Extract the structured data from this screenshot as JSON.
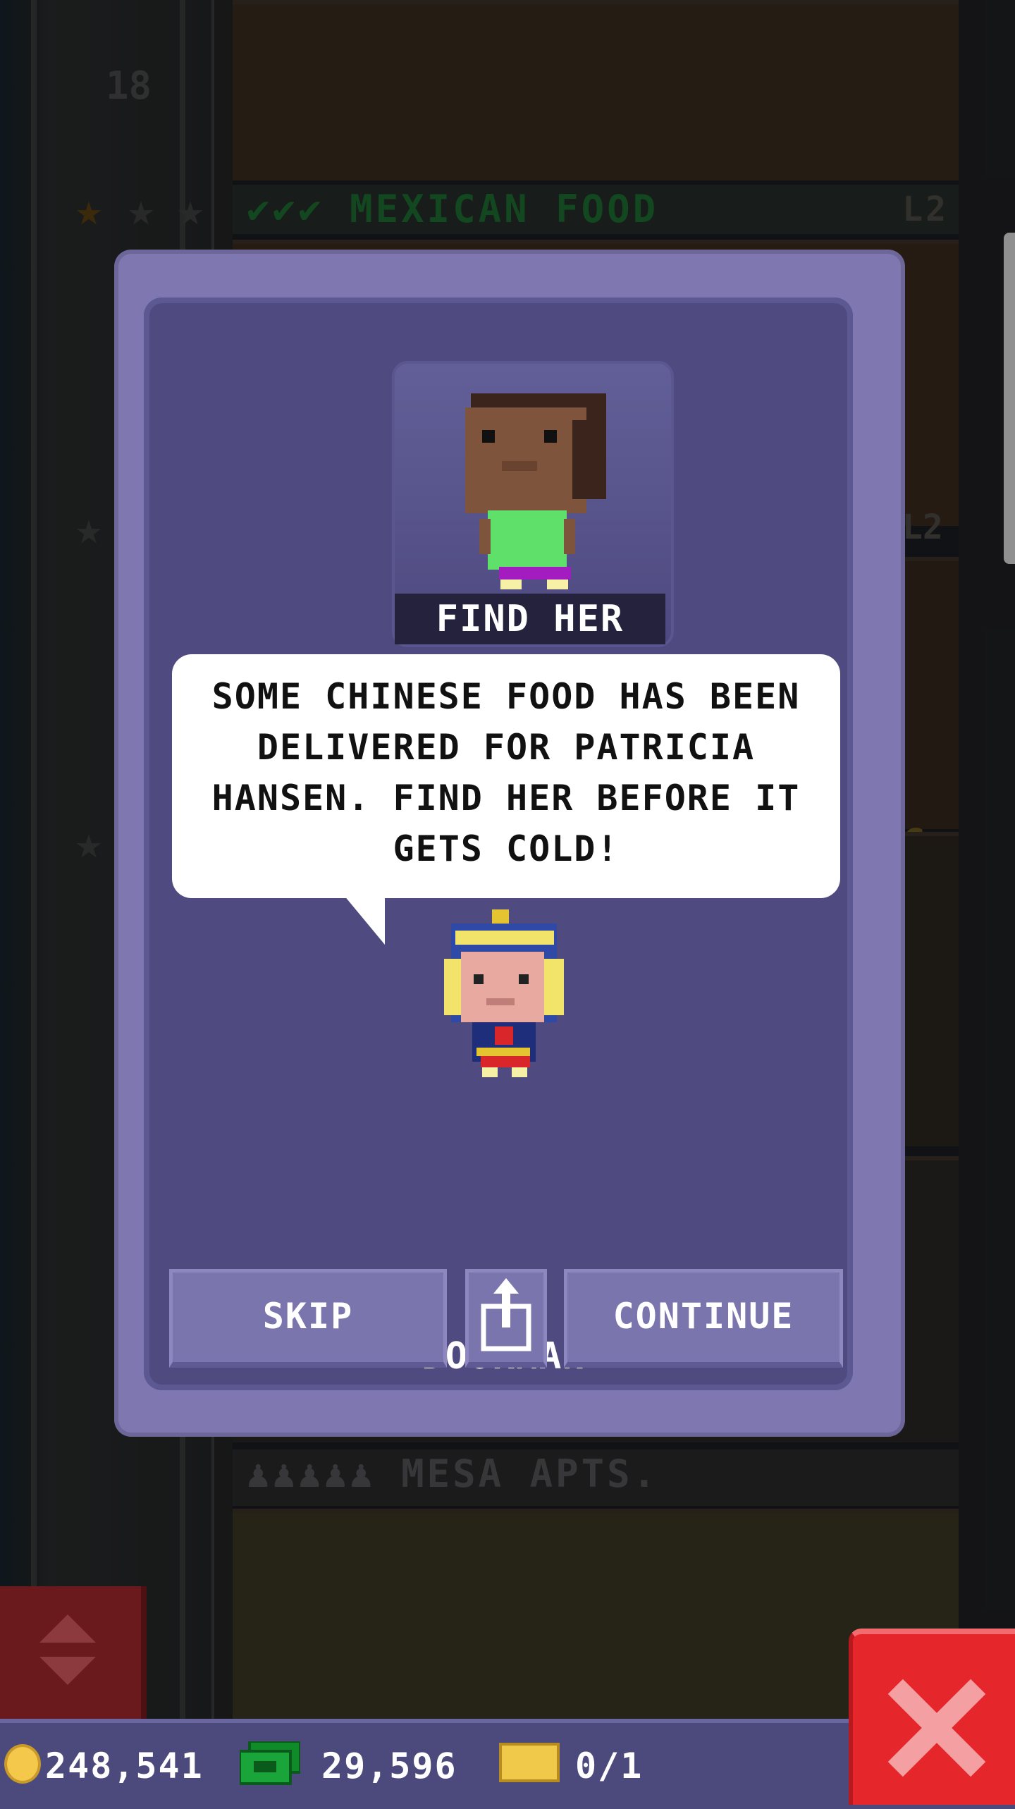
{
  "background": {
    "floor_18_number": "18",
    "floor_label_1": "MEXICAN FOOD",
    "floor_label_1_level": "L2",
    "floor_label_2_level": "L2",
    "floor_label_3": "MESA APTS.",
    "floor_label_3_partial": "G"
  },
  "dialog": {
    "portrait_label": "FIND HER",
    "message": "SOME CHINESE FOOD HAS BEEN DELIVERED FOR PATRICIA HANSEN. FIND HER BEFORE IT GETS COLD!",
    "speaker_name": "DOORMAN",
    "buttons": {
      "skip": "SKIP",
      "continue": "CONTINUE"
    }
  },
  "hud": {
    "coins": "248,541",
    "bux": "29,596",
    "tickets": "0/1"
  },
  "icons": {
    "portrait": "character-portrait-icon",
    "speaker": "doorman-avatar-icon",
    "share": "share-icon",
    "coin": "coin-icon",
    "bux": "bux-icon",
    "ticket": "ticket-icon",
    "close": "close-icon",
    "elevator": "elevator-arrows-icon"
  },
  "colors": {
    "dialog_bg": "#4f4b80",
    "dialog_frame": "#7f78b0",
    "button": "#7a75ad",
    "hud_bg": "#4c4a7c",
    "close_red": "#e5262b",
    "label_green": "#1d6d32"
  }
}
